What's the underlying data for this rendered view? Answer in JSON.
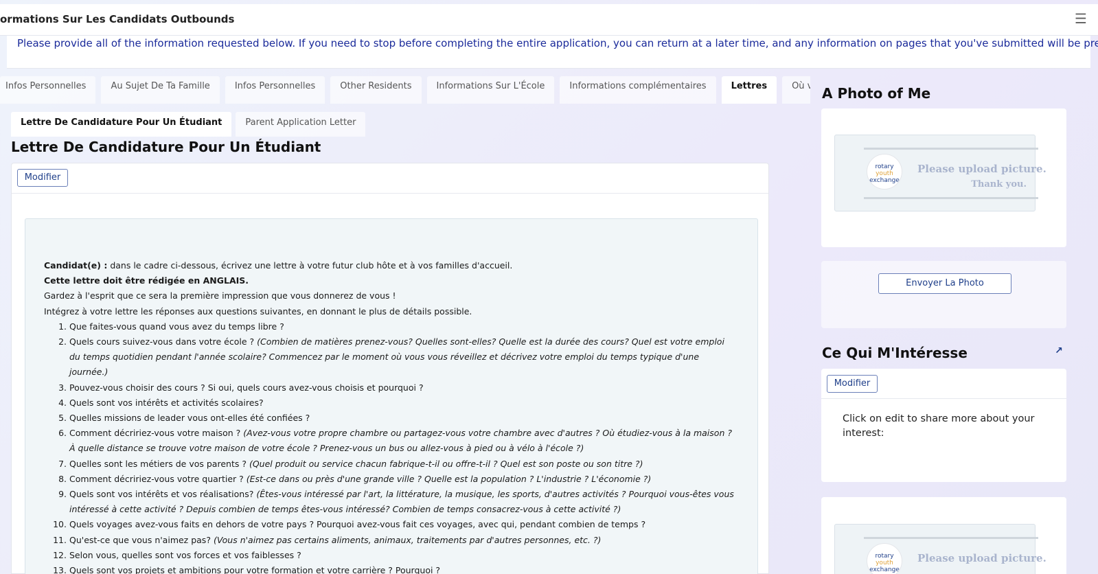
{
  "header": {
    "title": "ormations Sur Les Candidats Outbounds",
    "menu_icon": "hamburger-menu-icon"
  },
  "notice": "Please provide all of the information requested below. If you need to stop before completing the entire application, you can return at a later time, and any information on pages that you've submitted will be preserved.",
  "tabs": [
    {
      "label": "Infos Personnelles",
      "active": false
    },
    {
      "label": "Au Sujet De Ta Famille",
      "active": false
    },
    {
      "label": "Infos Personnelles",
      "active": false
    },
    {
      "label": "Other Residents",
      "active": false
    },
    {
      "label": "Informations Sur L'École",
      "active": false
    },
    {
      "label": "Informations complémentaires",
      "active": false
    },
    {
      "label": "Lettres",
      "active": true
    },
    {
      "label": "Où voudrais-t",
      "active": false
    }
  ],
  "subtabs": [
    {
      "label": "Lettre De Candidature Pour Un Étudiant",
      "active": true
    },
    {
      "label": "Parent Application Letter",
      "active": false
    }
  ],
  "section": {
    "title": "Lettre De Candidature Pour Un Étudiant",
    "edit_label": "Modifier"
  },
  "letter": {
    "intro_bold": "Candidat(e) :",
    "intro_rest": " dans le cadre ci-dessous, écrivez une lettre à votre futur club hôte et à vos familles d'accueil.",
    "english_note": "Cette lettre doit être rédigée en ANGLAIS.",
    "impression": "Gardez à l'esprit que ce sera la première impression que vous donnerez de vous !",
    "integrate": "Intégrez à votre lettre les réponses aux questions suivantes, en donnant le plus de détails possible.",
    "questions": [
      {
        "n": "1.",
        "text": "Que faites-vous quand vous avez du temps libre ?",
        "italic": ""
      },
      {
        "n": "2.",
        "text": "Quels cours suivez-vous dans votre école ? ",
        "italic": "(Combien de matières prenez-vous? Quelles sont-elles? Quelle est la durée des cours? Quel est votre emploi du temps quotidien pendant l'année scolaire? Commencez par le moment où vous vous réveillez et décrivez votre emploi du temps typique d'une journée.)"
      },
      {
        "n": "3.",
        "text": "Pouvez-vous choisir des cours ? Si oui, quels cours avez-vous choisis et pourquoi ?",
        "italic": ""
      },
      {
        "n": "4.",
        "text": "Quels sont vos intérêts et activités scolaires?",
        "italic": ""
      },
      {
        "n": "5.",
        "text": "Quelles missions de leader vous ont-elles été confiées ?",
        "italic": ""
      },
      {
        "n": "6.",
        "text": "Comment décririez-vous votre maison ? ",
        "italic": "(Avez-vous votre propre chambre ou partagez-vous votre chambre avec d'autres ? Où étudiez-vous à la maison ? À quelle distance se trouve votre maison de votre école ? Prenez-vous un bus ou allez-vous à pied ou à vélo à l'école ?)"
      },
      {
        "n": "7.",
        "text": "Quelles sont les métiers de vos parents ? ",
        "italic": "(Quel produit ou service chacun fabrique-t-il ou offre-t-il ? Quel est son poste ou son titre ?)"
      },
      {
        "n": "8.",
        "text": "Comment décririez-vous votre quartier ? ",
        "italic": "(Est-ce dans ou près d'une grande ville ? Quelle est la population ? L'industrie ? L'économie ?)"
      },
      {
        "n": "9.",
        "text": "Quels sont vos intérêts et vos réalisations? ",
        "italic": "(Êtes-vous intéressé par l'art, la littérature, la musique, les sports, d'autres activités ? Pourquoi vous-êtes vous intéressé à cette activité ? Depuis combien de temps êtes-vous intéressé? Combien de temps consacrez-vous à cette activité ?)"
      },
      {
        "n": "10.",
        "text": "Quels voyages avez-vous faits en dehors de votre pays ? Pourquoi avez-vous fait ces voyages, avec qui, pendant combien de temps ?",
        "italic": ""
      },
      {
        "n": "11.",
        "text": "Qu'est-ce que vous n'aimez pas? ",
        "italic": "(Vous n'aimez pas certains aliments, animaux, traitements par d'autres personnes, etc. ?)"
      },
      {
        "n": "12.",
        "text": "Selon vous, quelles sont vos forces et vos faiblesses ?",
        "italic": ""
      },
      {
        "n": "13.",
        "text": "Quels sont vos projets et ambitions pour votre formation et votre carrière ? Pourquoi ?",
        "italic": ""
      }
    ]
  },
  "photo": {
    "title": "A Photo of Me",
    "placeholder_line1": "Please upload picture.",
    "placeholder_line2": "Thank you.",
    "logo_text": [
      "rotary",
      "youth",
      "exchange"
    ],
    "upload_label": "Envoyer La Photo"
  },
  "interest": {
    "title": "Ce Qui M'Intéresse",
    "edit_label": "Modifier",
    "text": "Click on edit to share more about your interest:",
    "expand_icon": "external-expand-icon"
  },
  "colors": {
    "link_blue": "#1a2a9a",
    "button_border": "#6a7fb8",
    "letter_bg": "#f1f6f8"
  }
}
